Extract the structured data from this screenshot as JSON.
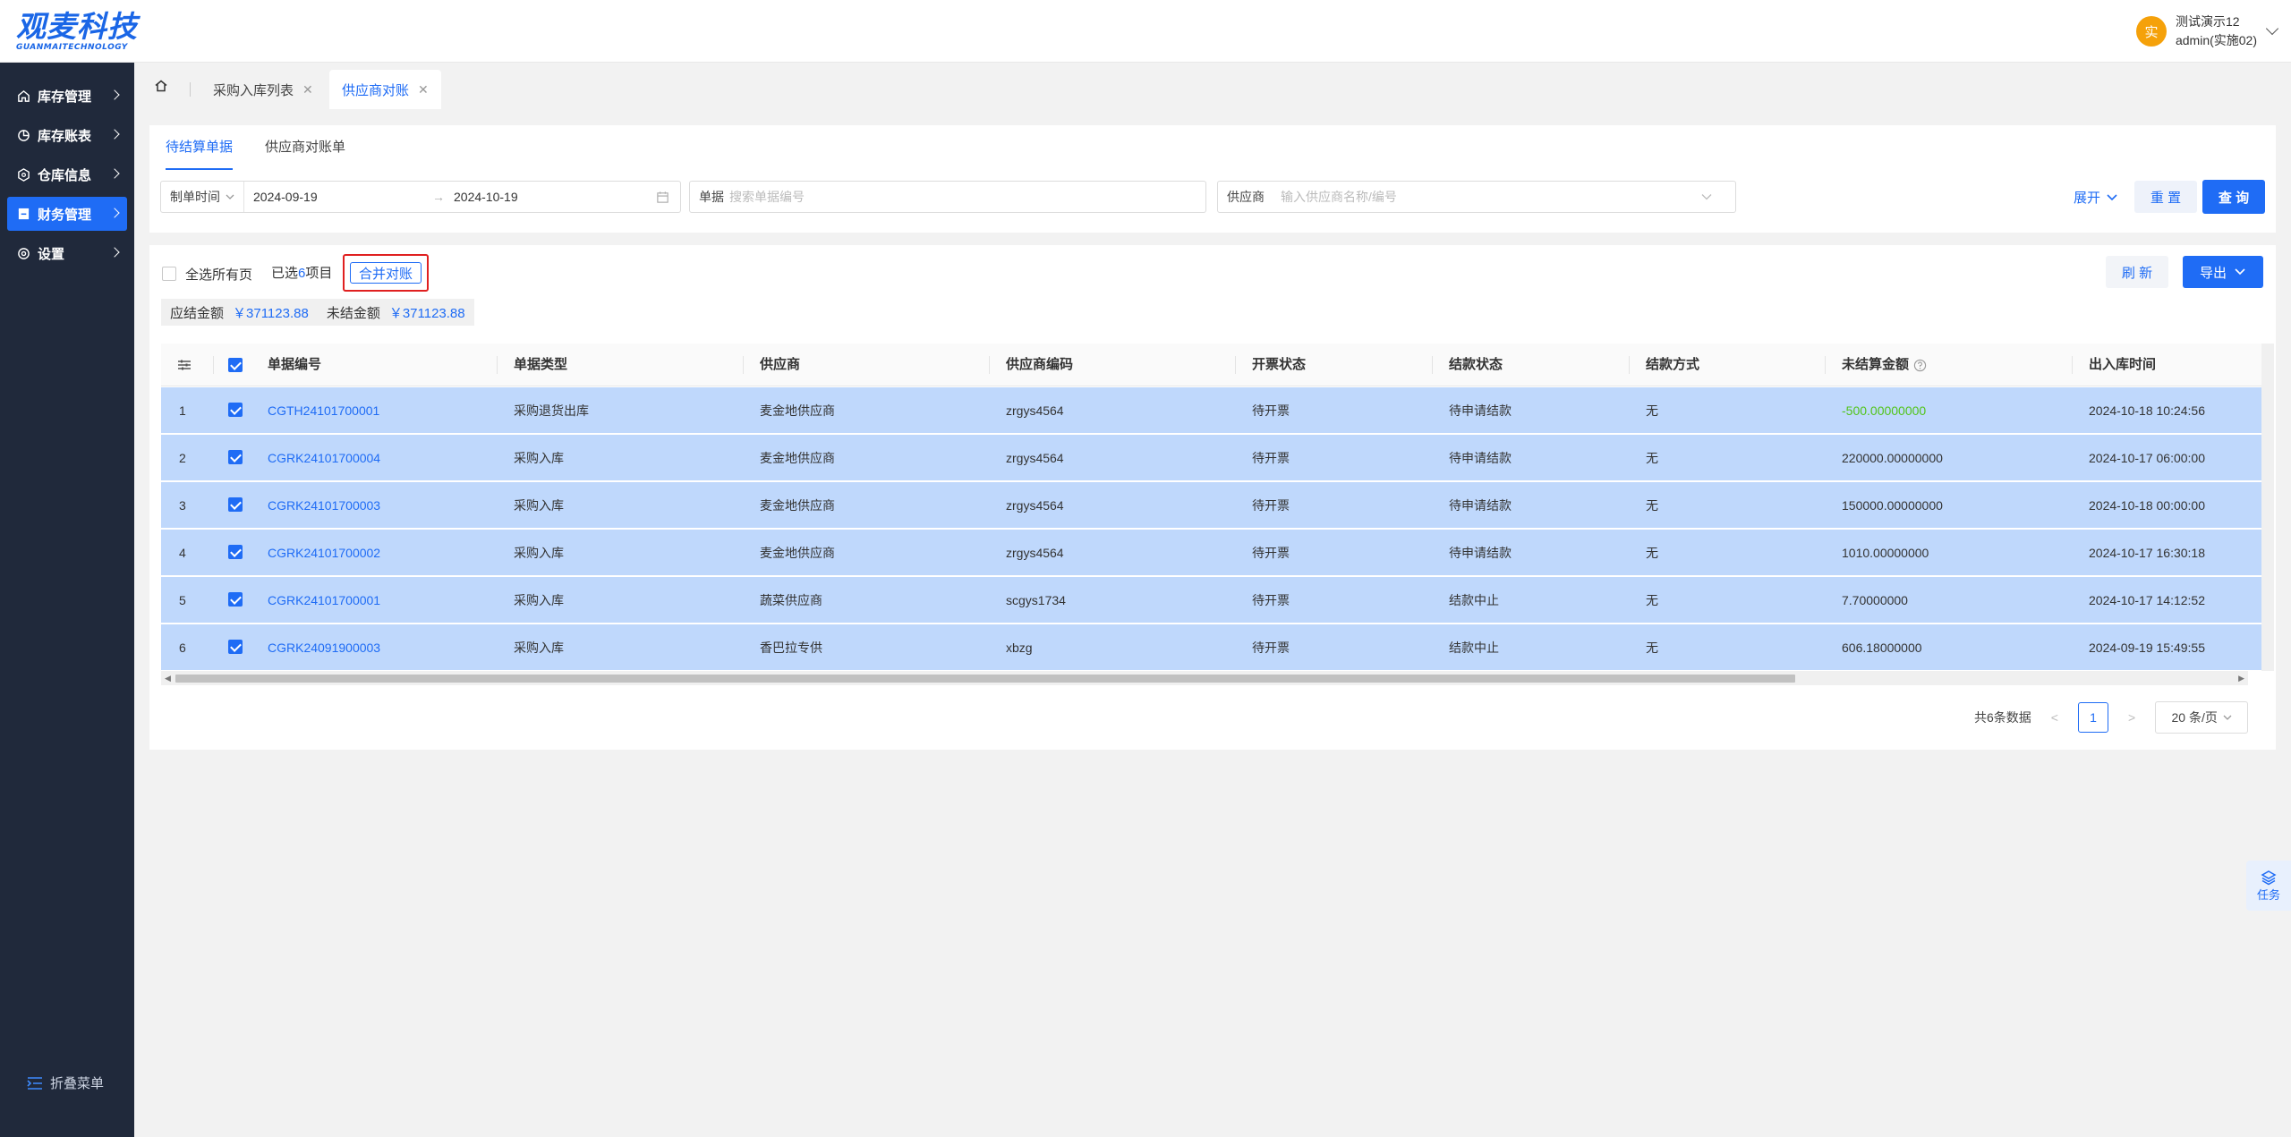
{
  "brand": {
    "name": "观麦科技",
    "subtitle": "GUANMAITECHNOLOGY"
  },
  "user": {
    "avatar_text": "实",
    "line1": "测试演示12",
    "line2": "admin(实施02)"
  },
  "sidebar": {
    "items": [
      {
        "label": "库存管理",
        "icon": "home-icon"
      },
      {
        "label": "库存账表",
        "icon": "chart-icon"
      },
      {
        "label": "仓库信息",
        "icon": "warehouse-icon"
      },
      {
        "label": "财务管理",
        "icon": "finance-icon",
        "active": true
      },
      {
        "label": "设置",
        "icon": "gear-icon"
      }
    ],
    "collapse_label": "折叠菜单"
  },
  "tabs": [
    {
      "label": "采购入库列表",
      "close": "✕"
    },
    {
      "label": "供应商对账",
      "close": "✕",
      "active": true
    }
  ],
  "subtabs": [
    {
      "label": "待结算单据",
      "active": true
    },
    {
      "label": "供应商对账单"
    }
  ],
  "filters": {
    "date_label": "制单时间",
    "date_start": "2024-09-19",
    "date_arrow": "→",
    "date_end": "2024-10-19",
    "doc_label": "单据",
    "doc_placeholder": "搜索单据编号",
    "supplier_label": "供应商",
    "supplier_placeholder": "输入供应商名称/编号",
    "expand_label": "展开",
    "reset_label": "重 置",
    "query_label": "查 询"
  },
  "toolbar": {
    "select_all_pages": "全选所有页",
    "selected_prefix": "已选",
    "selected_count": "6",
    "selected_suffix": "项目",
    "merge_label": "合并对账",
    "refresh_label": "刷 新",
    "export_label": "导出"
  },
  "summary": {
    "receivable_label": "应结金额",
    "receivable_value": "￥371123.88",
    "unsettled_label": "未结金额",
    "unsettled_value": "￥371123.88"
  },
  "table": {
    "columns": [
      "单据编号",
      "单据类型",
      "供应商",
      "供应商编码",
      "开票状态",
      "结款状态",
      "结款方式",
      "未结算金额",
      "出入库时间"
    ],
    "rows": [
      {
        "idx": "1",
        "doc": "CGTH24101700001",
        "type": "采购退货出库",
        "supplier": "麦金地供应商",
        "code": "zrgys4564",
        "invoice": "待开票",
        "pay_status": "待申请结款",
        "pay_method": "无",
        "amount": "-500.00000000",
        "time": "2024-10-18 10:24:56"
      },
      {
        "idx": "2",
        "doc": "CGRK24101700004",
        "type": "采购入库",
        "supplier": "麦金地供应商",
        "code": "zrgys4564",
        "invoice": "待开票",
        "pay_status": "待申请结款",
        "pay_method": "无",
        "amount": "220000.00000000",
        "time": "2024-10-17 06:00:00"
      },
      {
        "idx": "3",
        "doc": "CGRK24101700003",
        "type": "采购入库",
        "supplier": "麦金地供应商",
        "code": "zrgys4564",
        "invoice": "待开票",
        "pay_status": "待申请结款",
        "pay_method": "无",
        "amount": "150000.00000000",
        "time": "2024-10-18 00:00:00"
      },
      {
        "idx": "4",
        "doc": "CGRK24101700002",
        "type": "采购入库",
        "supplier": "麦金地供应商",
        "code": "zrgys4564",
        "invoice": "待开票",
        "pay_status": "待申请结款",
        "pay_method": "无",
        "amount": "1010.00000000",
        "time": "2024-10-17 16:30:18"
      },
      {
        "idx": "5",
        "doc": "CGRK24101700001",
        "type": "采购入库",
        "supplier": "蔬菜供应商",
        "code": "scgys1734",
        "invoice": "待开票",
        "pay_status": "结款中止",
        "pay_method": "无",
        "amount": "7.70000000",
        "time": "2024-10-17 14:12:52"
      },
      {
        "idx": "6",
        "doc": "CGRK24091900003",
        "type": "采购入库",
        "supplier": "香巴拉专供",
        "code": "xbzg",
        "invoice": "待开票",
        "pay_status": "结款中止",
        "pay_method": "无",
        "amount": "606.18000000",
        "time": "2024-09-19 15:49:55"
      }
    ]
  },
  "pagination": {
    "total": "共6条数据",
    "current": "1",
    "page_size": "20 条/页",
    "prev": "<",
    "next": ">"
  },
  "task_button": {
    "label": "任务"
  },
  "colors": {
    "primary": "#1f6cf5",
    "sidebar_bg": "#20293b",
    "row_selected": "#bfd8fc",
    "negative_amount": "#52c41a",
    "highlight_border": "#e02020"
  }
}
